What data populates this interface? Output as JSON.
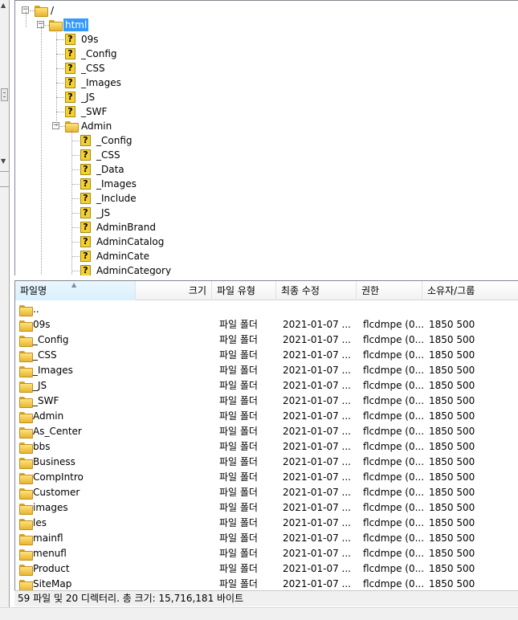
{
  "tree": {
    "root_label": "/",
    "selected_label": "html",
    "html_children": [
      "09s",
      "_Config",
      "_CSS",
      "_Images",
      "_JS",
      "_SWF",
      "Admin"
    ],
    "admin_children": [
      "_Config",
      "_CSS",
      "_Data",
      "_Images",
      "_Include",
      "_JS",
      "AdminBrand",
      "AdminCatalog",
      "AdminCate",
      "AdminCategory"
    ]
  },
  "list": {
    "columns": [
      "파일명",
      "크기",
      "파일 유형",
      "최종 수정",
      "권한",
      "소유자/그룹"
    ],
    "parent_row": "..",
    "rows": [
      {
        "name": "09s",
        "type": "파일 폴더",
        "modified": "2021-01-07 ...",
        "perms": "flcdmpe (0...",
        "owner": "1850 500"
      },
      {
        "name": "_Config",
        "type": "파일 폴더",
        "modified": "2021-01-07 ...",
        "perms": "flcdmpe (0...",
        "owner": "1850 500"
      },
      {
        "name": "_CSS",
        "type": "파일 폴더",
        "modified": "2021-01-07 ...",
        "perms": "flcdmpe (0...",
        "owner": "1850 500"
      },
      {
        "name": "_Images",
        "type": "파일 폴더",
        "modified": "2021-01-07 ...",
        "perms": "flcdmpe (0...",
        "owner": "1850 500"
      },
      {
        "name": "_JS",
        "type": "파일 폴더",
        "modified": "2021-01-07 ...",
        "perms": "flcdmpe (0...",
        "owner": "1850 500"
      },
      {
        "name": "_SWF",
        "type": "파일 폴더",
        "modified": "2021-01-07 ...",
        "perms": "flcdmpe (0...",
        "owner": "1850 500"
      },
      {
        "name": "Admin",
        "type": "파일 폴더",
        "modified": "2021-01-07 ...",
        "perms": "flcdmpe (0...",
        "owner": "1850 500"
      },
      {
        "name": "As_Center",
        "type": "파일 폴더",
        "modified": "2021-01-07 ...",
        "perms": "flcdmpe (0...",
        "owner": "1850 500"
      },
      {
        "name": "bbs",
        "type": "파일 폴더",
        "modified": "2021-01-07 ...",
        "perms": "flcdmpe (0...",
        "owner": "1850 500"
      },
      {
        "name": "Business",
        "type": "파일 폴더",
        "modified": "2021-01-07 ...",
        "perms": "flcdmpe (0...",
        "owner": "1850 500"
      },
      {
        "name": "CompIntro",
        "type": "파일 폴더",
        "modified": "2021-01-07 ...",
        "perms": "flcdmpe (0...",
        "owner": "1850 500"
      },
      {
        "name": "Customer",
        "type": "파일 폴더",
        "modified": "2021-01-07 ...",
        "perms": "flcdmpe (0...",
        "owner": "1850 500"
      },
      {
        "name": "images",
        "type": "파일 폴더",
        "modified": "2021-01-07 ...",
        "perms": "flcdmpe (0...",
        "owner": "1850 500"
      },
      {
        "name": "les",
        "type": "파일 폴더",
        "modified": "2021-01-07 ...",
        "perms": "flcdmpe (0...",
        "owner": "1850 500"
      },
      {
        "name": "mainfl",
        "type": "파일 폴더",
        "modified": "2021-01-07 ...",
        "perms": "flcdmpe (0...",
        "owner": "1850 500"
      },
      {
        "name": "menufl",
        "type": "파일 폴더",
        "modified": "2021-01-07 ...",
        "perms": "flcdmpe (0...",
        "owner": "1850 500"
      },
      {
        "name": "Product",
        "type": "파일 폴더",
        "modified": "2021-01-07 ...",
        "perms": "flcdmpe (0...",
        "owner": "1850 500"
      },
      {
        "name": "SiteMap",
        "type": "파일 폴더",
        "modified": "2021-01-07 ...",
        "perms": "flcdmpe (0...",
        "owner": "1850 500"
      }
    ]
  },
  "status": {
    "text": "59 파일 및 20 디렉터리. 총 크기: 15,716,181 바이트"
  },
  "icons": {
    "folder": "folder-icon",
    "unknown": "question-mark-icon"
  },
  "colors": {
    "selection": "#3399ff",
    "folder": "#f5c842"
  }
}
